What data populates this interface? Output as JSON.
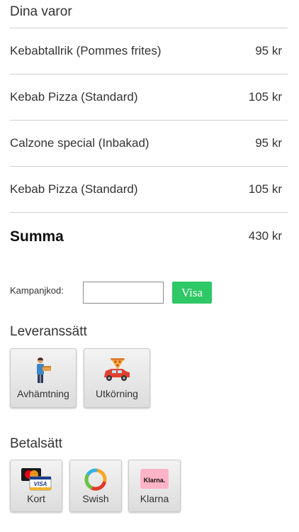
{
  "cart": {
    "title": "Dina varor",
    "items": [
      {
        "name": "Kebabtallrik (Pommes frites)",
        "price": "95 kr"
      },
      {
        "name": "Kebab Pizza (Standard)",
        "price": "105 kr"
      },
      {
        "name": "Calzone special (Inbakad)",
        "price": "95 kr"
      },
      {
        "name": "Kebab Pizza (Standard)",
        "price": "105 kr"
      }
    ],
    "sum_label": "Summa",
    "sum_value": "430 kr"
  },
  "promo": {
    "label": "Kampanjkod:",
    "input_value": "",
    "button_label": "Visa"
  },
  "delivery": {
    "title": "Leveranssätt",
    "options": [
      {
        "label": "Avhämtning",
        "icon": "pickup-person-icon"
      },
      {
        "label": "Utkörning",
        "icon": "delivery-car-icon"
      }
    ]
  },
  "payment": {
    "title": "Betalsätt",
    "options": [
      {
        "label": "Kort",
        "icon": "credit-card-icon"
      },
      {
        "label": "Swish",
        "icon": "swish-icon"
      },
      {
        "label": "Klarna",
        "icon": "klarna-icon",
        "icon_text": "Klarna."
      }
    ]
  },
  "colors": {
    "accent": "#2ec866",
    "divider": "#cfcfcf",
    "klarna": "#ffb3c7"
  }
}
